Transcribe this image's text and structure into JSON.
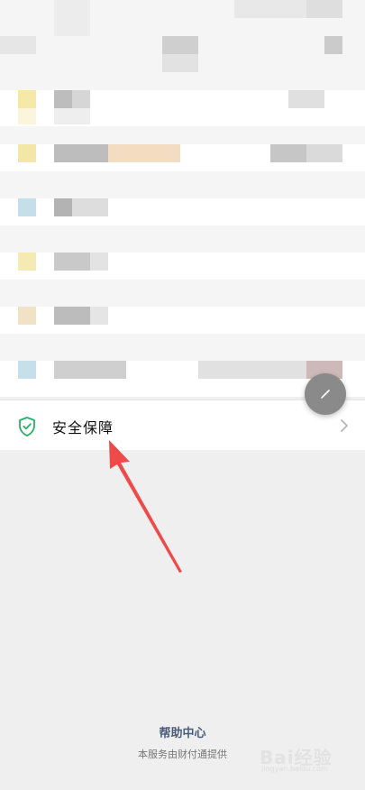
{
  "menu": {
    "security_label": "安全保障"
  },
  "footer": {
    "help_center": "帮助中心",
    "provider_note": "本服务由财付通提供"
  },
  "watermark": {
    "text": "Bai经验",
    "sub": "jingyan.baidu.com"
  },
  "colors": {
    "shield_green": "#2aae67",
    "arrow_red": "#ef4a4a",
    "footer_link": "#4a5c7a",
    "background": "#efefef"
  },
  "icons": [
    "shield-icon",
    "chevron-right-icon",
    "edit-icon"
  ]
}
